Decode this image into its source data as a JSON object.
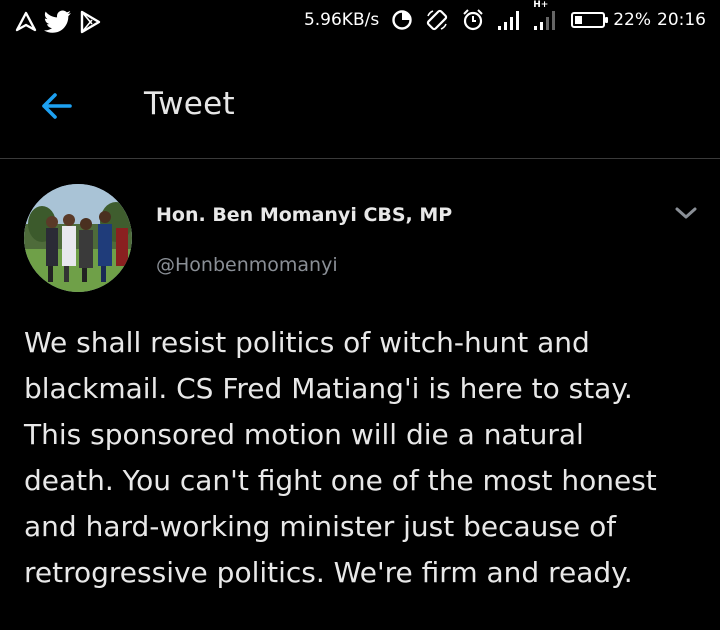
{
  "status_bar": {
    "net_speed": "5.96KB/s",
    "network_type": "H+",
    "battery_percent": 22,
    "battery_text": "22%",
    "time": "20:16",
    "left_icons": [
      "navigation-icon",
      "twitter-bird-icon",
      "play-store-icon"
    ],
    "right_icons": [
      "data-saver-icon",
      "rotate-icon",
      "alarm-icon",
      "signal-icon",
      "signal-2-icon",
      "battery-icon"
    ]
  },
  "header": {
    "back_icon": "arrow-left-icon",
    "title": "Tweet",
    "accent_color": "#1da1f2"
  },
  "tweet": {
    "display_name": "Hon. Ben Momanyi CBS, MP",
    "handle": "@Honbenmomanyi",
    "more_icon": "chevron-down-icon",
    "text": "We shall resist politics of witch-hunt and\nblackmail. CS Fred Matiang'i is here to stay.\nThis sponsored motion will die a natural\ndeath. You can't fight one of the most honest\nand hard-working minister just because of\nretrogressive politics. We're firm and ready."
  }
}
